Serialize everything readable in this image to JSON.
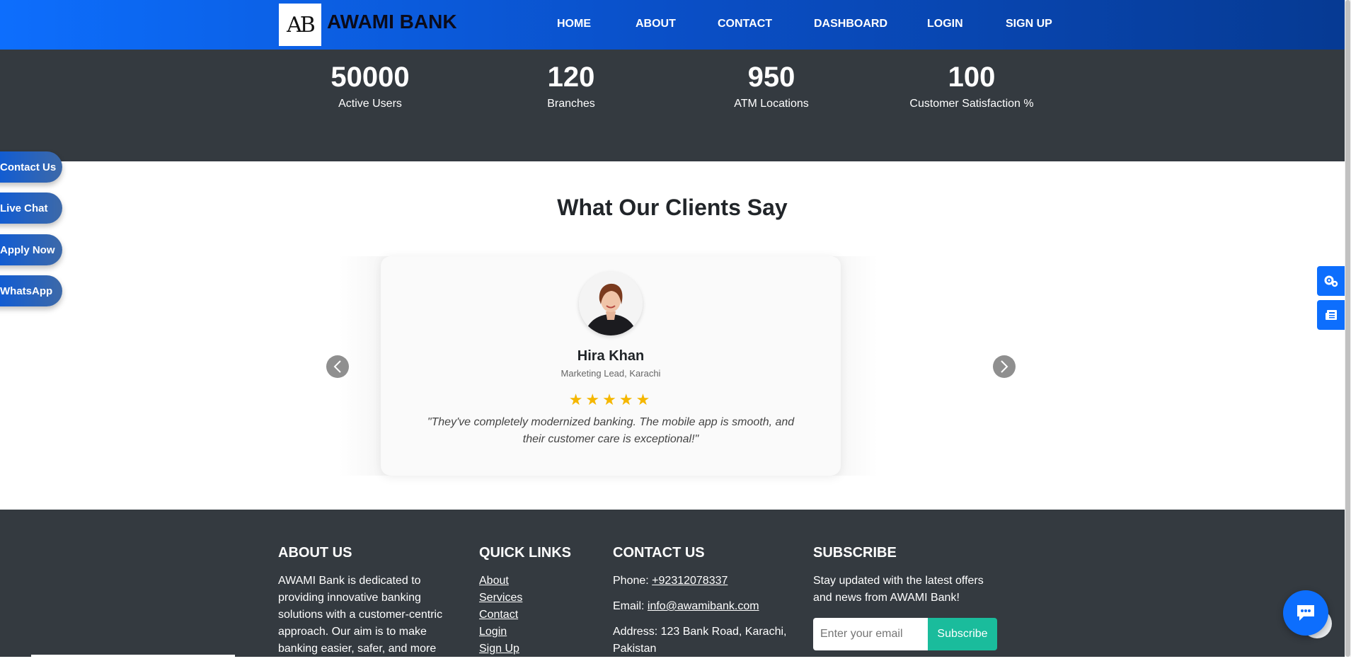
{
  "header": {
    "logo_text": "AB",
    "brand": "AWAMI BANK",
    "nav": [
      "HOME",
      "ABOUT",
      "CONTACT",
      "DASHBOARD",
      "LOGIN",
      "SIGN UP"
    ]
  },
  "stats": [
    {
      "value": "50000",
      "label": "Active Users"
    },
    {
      "value": "120",
      "label": "Branches"
    },
    {
      "value": "950",
      "label": "ATM Locations"
    },
    {
      "value": "100",
      "label": "Customer Satisfaction %"
    }
  ],
  "floating_buttons": [
    "Contact Us",
    "Live Chat",
    "Apply Now",
    "WhatsApp"
  ],
  "side_tabs": [
    "gears-icon",
    "newspaper-icon"
  ],
  "testimonials": {
    "title": "What Our Clients Say",
    "name": "Hira Khan",
    "role": "Marketing Lead, Karachi",
    "stars": "★★★★★",
    "rating": 5,
    "quote": "\"They've completely modernized banking. The mobile app is smooth, and their customer care is exceptional!\""
  },
  "footer": {
    "about": {
      "title": "ABOUT US",
      "text": "AWAMI Bank is dedicated to providing innovative banking solutions with a customer-centric approach. Our aim is to make banking easier, safer, and more"
    },
    "quick_links": {
      "title": "QUICK LINKS",
      "links": [
        "About",
        "Services",
        "Contact",
        "Login",
        "Sign Up"
      ]
    },
    "contact": {
      "title": "CONTACT US",
      "phone_label": "Phone:",
      "phone": "+92312078337",
      "email_label": "Email:",
      "email": "info@awamibank.com",
      "address": "Address: 123 Bank Road, Karachi, Pakistan"
    },
    "subscribe": {
      "title": "SUBSCRIBE",
      "text": "Stay updated with the latest offers and news from AWAMI Bank!",
      "placeholder": "Enter your email",
      "button": "Subscribe"
    }
  },
  "colors": {
    "primary": "#0d6efd",
    "dark": "#343a40",
    "accent": "#1abc9c",
    "star": "#f5b700"
  }
}
